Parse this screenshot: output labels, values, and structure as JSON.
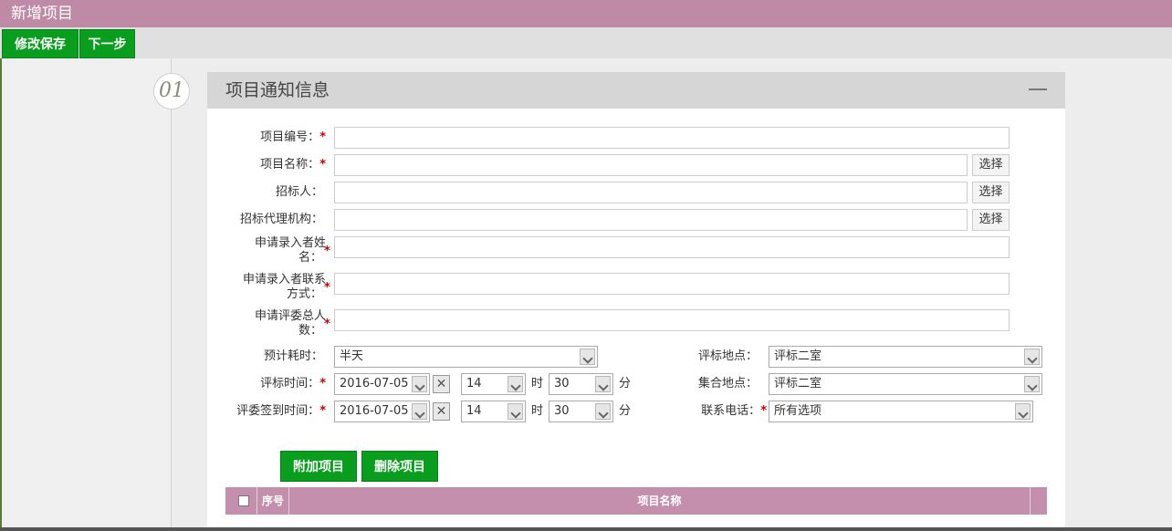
{
  "window": {
    "title": "新增项目"
  },
  "toolbar": {
    "save_label": "修改保存",
    "next_label": "下一步"
  },
  "step": {
    "number": "01"
  },
  "section": {
    "title": "项目通知信息"
  },
  "form": {
    "project_code": {
      "label": "项目编号：",
      "value": ""
    },
    "project_name": {
      "label": "项目名称：",
      "value": "",
      "pick_label": "选择"
    },
    "tenderer": {
      "label": "招标人：",
      "value": "",
      "pick_label": "选择"
    },
    "agency": {
      "label": "招标代理机构：",
      "value": "",
      "pick_label": "选择"
    },
    "applicant_name": {
      "label_line1": "申请录入者姓",
      "label_line2": "名：",
      "value": ""
    },
    "applicant_contact": {
      "label_line1": "申请录入者联系",
      "label_line2": "方式：",
      "value": ""
    },
    "reviewer_count": {
      "label_line1": "申请评委总人",
      "label_line2": "数：",
      "value": ""
    },
    "duration": {
      "label": "预计耗时：",
      "value": "半天"
    },
    "venue": {
      "label": "评标地点：",
      "value": "评标二室"
    },
    "review_time": {
      "label": "评标时间：",
      "date": "2016-07-05",
      "hour": "14",
      "minute": "30",
      "hour_unit": "时",
      "minute_unit": "分"
    },
    "gather_place": {
      "label": "集合地点：",
      "value": "评标二室"
    },
    "checkin_time": {
      "label": "评委签到时间：",
      "date": "2016-07-05",
      "hour": "14",
      "minute": "30",
      "hour_unit": "时",
      "minute_unit": "分"
    },
    "phone": {
      "label": "联系电话：",
      "value": "所有选项"
    },
    "clear_glyph": "✕"
  },
  "actions": {
    "add_label": "附加项目",
    "delete_label": "删除项目"
  },
  "table": {
    "columns": [
      "序号",
      "项目名称"
    ]
  },
  "colors": {
    "brand": "#bf8aa6",
    "button": "#0a9e1e",
    "table_header": "#c48fad"
  }
}
